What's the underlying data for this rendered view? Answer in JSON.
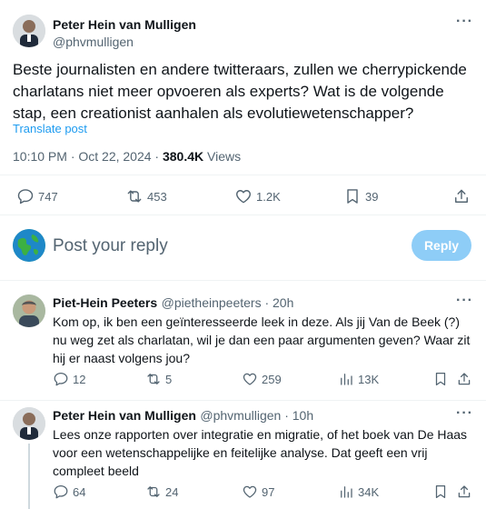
{
  "main_tweet": {
    "author_name": "Peter Hein van Mulligen",
    "author_handle": "@phvmulligen",
    "text": "Beste journalisten en andere twitteraars, zullen we cherrypickende charlatans niet meer opvoeren als experts? Wat is de volgende stap, een creationist aanhalen als evolutiewetenschapper?",
    "translate_label": "Translate post",
    "time": "10:10 PM · Oct 22, 2024 · ",
    "views_count": "380.4K",
    "views_label": " Views",
    "replies": "747",
    "reposts": "453",
    "likes": "1.2K",
    "bookmarks": "39",
    "more": "···"
  },
  "composer": {
    "placeholder": "Post your reply",
    "button_label": "Reply"
  },
  "replies": [
    {
      "author_name": "Piet-Hein Peeters",
      "author_handle": "@pietheinpeeters · 20h",
      "text": "Kom op, ik ben een geïnteresseerde leek in deze. Als jij Van de Beek (?) nu weg zet als charlatan, wil je dan een paar argumenten geven? Waar zit hij er naast volgens jou?",
      "replies": "12",
      "reposts": "5",
      "likes": "259",
      "views": "13K",
      "more": "···"
    },
    {
      "author_name": "Peter Hein van Mulligen",
      "author_handle": "@phvmulligen · 10h",
      "text": "Lees onze rapporten over integratie en migratie, of het boek van De Haas voor een wetenschappelijke en feitelijke analyse. Dat geeft een vrij compleet beeld",
      "replies": "64",
      "reposts": "24",
      "likes": "97",
      "views": "34K",
      "more": "···"
    }
  ],
  "colors": {
    "accent": "#1d9bf0",
    "reply_button": "#8ecdf7",
    "secondary_text": "#536471"
  }
}
